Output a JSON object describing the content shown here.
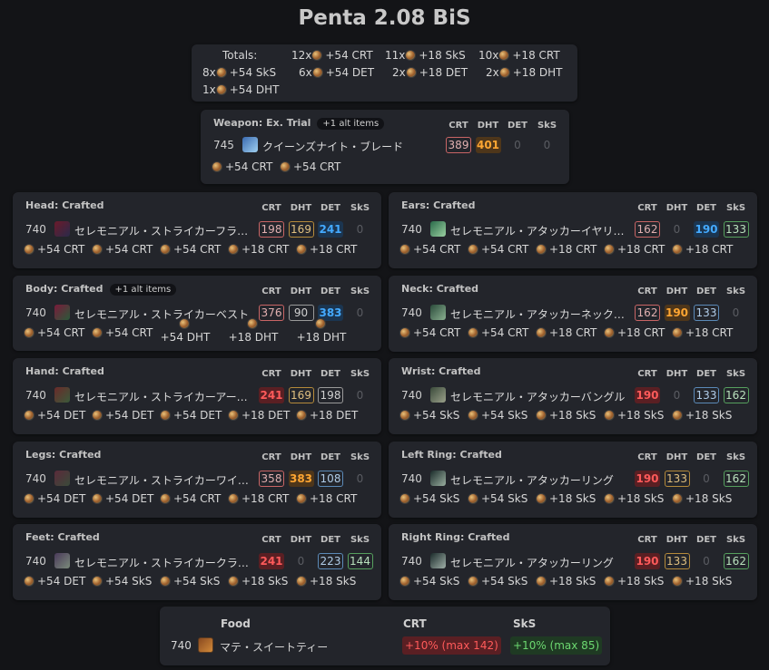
{
  "page": {
    "title": "Penta 2.08 BiS"
  },
  "stats": [
    "CRT",
    "DHT",
    "DET",
    "SkS"
  ],
  "totals": {
    "label": "Totals:",
    "rows": [
      [
        {
          "n": "12x",
          "t": "+54 CRT"
        },
        {
          "n": "11x",
          "t": "+18 SkS"
        },
        {
          "n": "10x",
          "t": "+18 CRT"
        }
      ],
      [
        {
          "n": "8x",
          "t": "+54 SkS"
        },
        {
          "n": "6x",
          "t": "+54 DET"
        },
        {
          "n": "2x",
          "t": "+18 DET"
        },
        {
          "n": "2x",
          "t": "+18 DHT"
        }
      ],
      [
        {
          "n": "1x",
          "t": "+54 DHT"
        }
      ]
    ]
  },
  "weapon": {
    "slot": "Weapon: Ex. Trial",
    "alt": "+1 alt items",
    "ilvl": "745",
    "name": "クイーンズナイト・ブレード",
    "stats": [
      "389",
      "401",
      "0",
      "0"
    ],
    "materia": [
      "+54 CRT",
      "+54 CRT"
    ]
  },
  "gear": [
    {
      "slot": "Head: Crafted",
      "ilvl": "740",
      "name": "セレモニアル・ストライカーフラ…",
      "stats": [
        "198",
        "169",
        "241",
        "0"
      ],
      "materia": [
        "+54 CRT",
        "+54 CRT",
        "+54 CRT",
        "+18 CRT",
        "+18 CRT"
      ]
    },
    {
      "slot": "Ears: Crafted",
      "ilvl": "740",
      "name": "セレモニアル・アタッカーイヤリ…",
      "stats": [
        "162",
        "0",
        "190",
        "133"
      ],
      "materia": [
        "+54 CRT",
        "+54 CRT",
        "+18 CRT",
        "+18 CRT",
        "+18 CRT"
      ]
    },
    {
      "slot": "Body: Crafted",
      "alt": "+1 alt items",
      "ilvl": "740",
      "name": "セレモニアル・ストライカーベスト",
      "stats": [
        "376",
        "90",
        "383",
        "0"
      ],
      "materia": [
        "+54 CRT",
        "+54 CRT",
        "+54 DHT",
        "+18 DHT",
        "+18 DHT"
      ]
    },
    {
      "slot": "Neck: Crafted",
      "ilvl": "740",
      "name": "セレモニアル・アタッカーネック…",
      "stats": [
        "162",
        "190",
        "133",
        "0"
      ],
      "materia": [
        "+54 CRT",
        "+54 CRT",
        "+18 CRT",
        "+18 CRT",
        "+18 CRT"
      ]
    },
    {
      "slot": "Hand: Crafted",
      "ilvl": "740",
      "name": "セレモニアル・ストライカーアー…",
      "stats": [
        "241",
        "169",
        "198",
        "0"
      ],
      "materia": [
        "+54 DET",
        "+54 DET",
        "+54 DET",
        "+18 DET",
        "+18 DET"
      ]
    },
    {
      "slot": "Wrist: Crafted",
      "ilvl": "740",
      "name": "セレモニアル・アタッカーバングル",
      "stats": [
        "190",
        "0",
        "133",
        "162"
      ],
      "materia": [
        "+54 SkS",
        "+54 SkS",
        "+18 SkS",
        "+18 SkS",
        "+18 SkS"
      ]
    },
    {
      "slot": "Legs: Crafted",
      "ilvl": "740",
      "name": "セレモニアル・ストライカーワイ…",
      "stats": [
        "358",
        "383",
        "108",
        "0"
      ],
      "materia": [
        "+54 DET",
        "+54 DET",
        "+54 CRT",
        "+18 CRT",
        "+18 CRT"
      ]
    },
    {
      "slot": "Left Ring: Crafted",
      "ilvl": "740",
      "name": "セレモニアル・アタッカーリング",
      "stats": [
        "190",
        "133",
        "0",
        "162"
      ],
      "materia": [
        "+54 SkS",
        "+54 SkS",
        "+18 SkS",
        "+18 SkS",
        "+18 SkS"
      ]
    },
    {
      "slot": "Feet: Crafted",
      "ilvl": "740",
      "name": "セレモニアル・ストライカークラ…",
      "stats": [
        "241",
        "0",
        "223",
        "144"
      ],
      "materia": [
        "+54 DET",
        "+54 SkS",
        "+54 SkS",
        "+18 SkS",
        "+18 SkS"
      ]
    },
    {
      "slot": "Right Ring: Crafted",
      "ilvl": "740",
      "name": "セレモニアル・アタッカーリング",
      "stats": [
        "190",
        "133",
        "0",
        "162"
      ],
      "materia": [
        "+54 SkS",
        "+54 SkS",
        "+18 SkS",
        "+18 SkS",
        "+18 SkS"
      ]
    }
  ],
  "food": {
    "label": "Food",
    "ilvl": "740",
    "name": "マテ・スイートティー",
    "stat1": "CRT",
    "stat2": "SkS",
    "val1": "+10% (max 142)",
    "val2": "+10% (max 85)"
  },
  "colors": {
    "crt_high": "#ff5a5a",
    "dht_high": "#ffa632",
    "det_high": "#44aaff",
    "sks_border": "#56a05e"
  }
}
